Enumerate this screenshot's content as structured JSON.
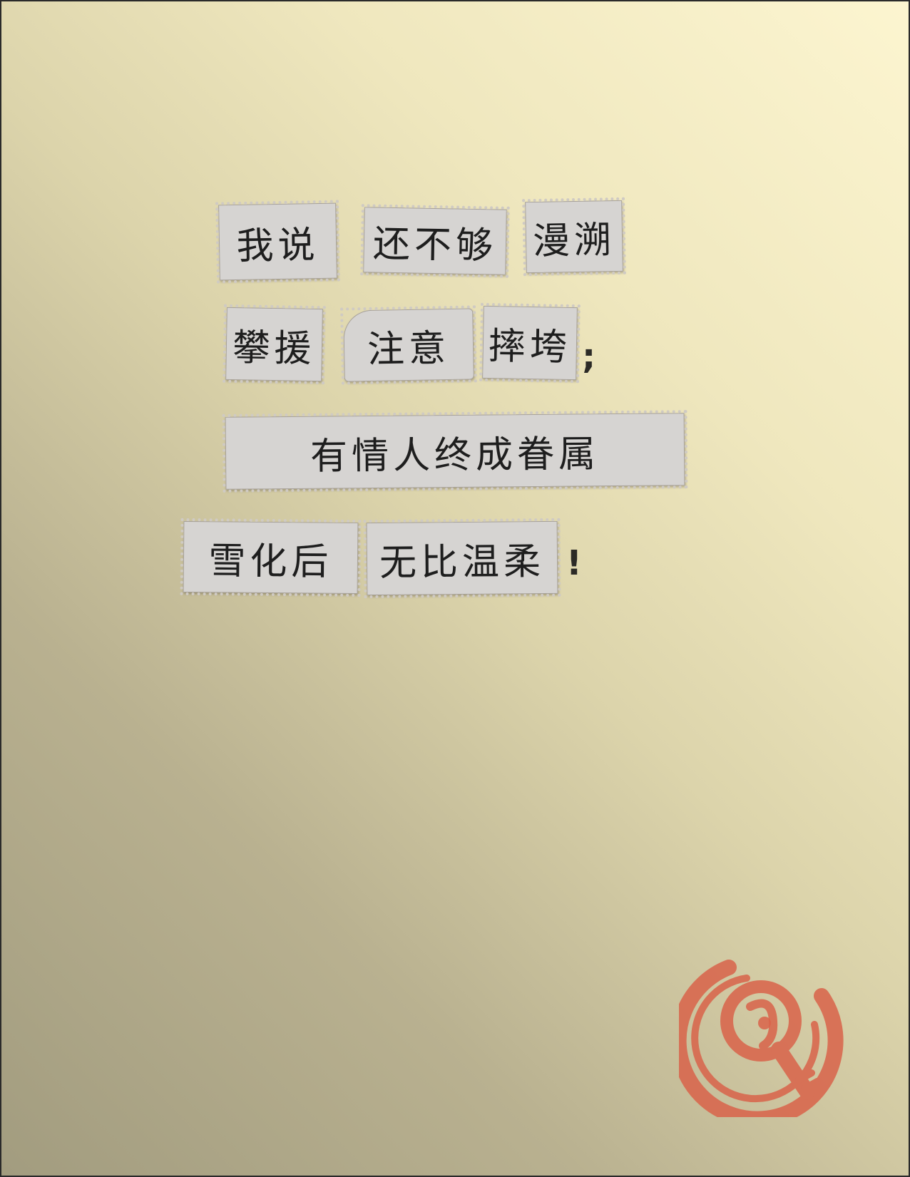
{
  "poem": {
    "line1": {
      "clip1": "我说",
      "clip2": "还不够",
      "clip3": "漫溯"
    },
    "line2": {
      "clip1": "攀援",
      "clip2": "注意",
      "clip3": "摔垮",
      "punct": ";"
    },
    "line3": {
      "clip1": "有情人终成眷属"
    },
    "line4": {
      "clip1": "雪化后",
      "clip2": "无比温柔",
      "punct": "!"
    }
  },
  "logo": {
    "icon": "key-in-circle-seal-icon",
    "color": "#d9634a"
  },
  "colors": {
    "paper": "#d6d4d2",
    "ink": "#1e1e1e",
    "background_light": "#fcf5d0",
    "background_dark": "#a29c7f"
  }
}
